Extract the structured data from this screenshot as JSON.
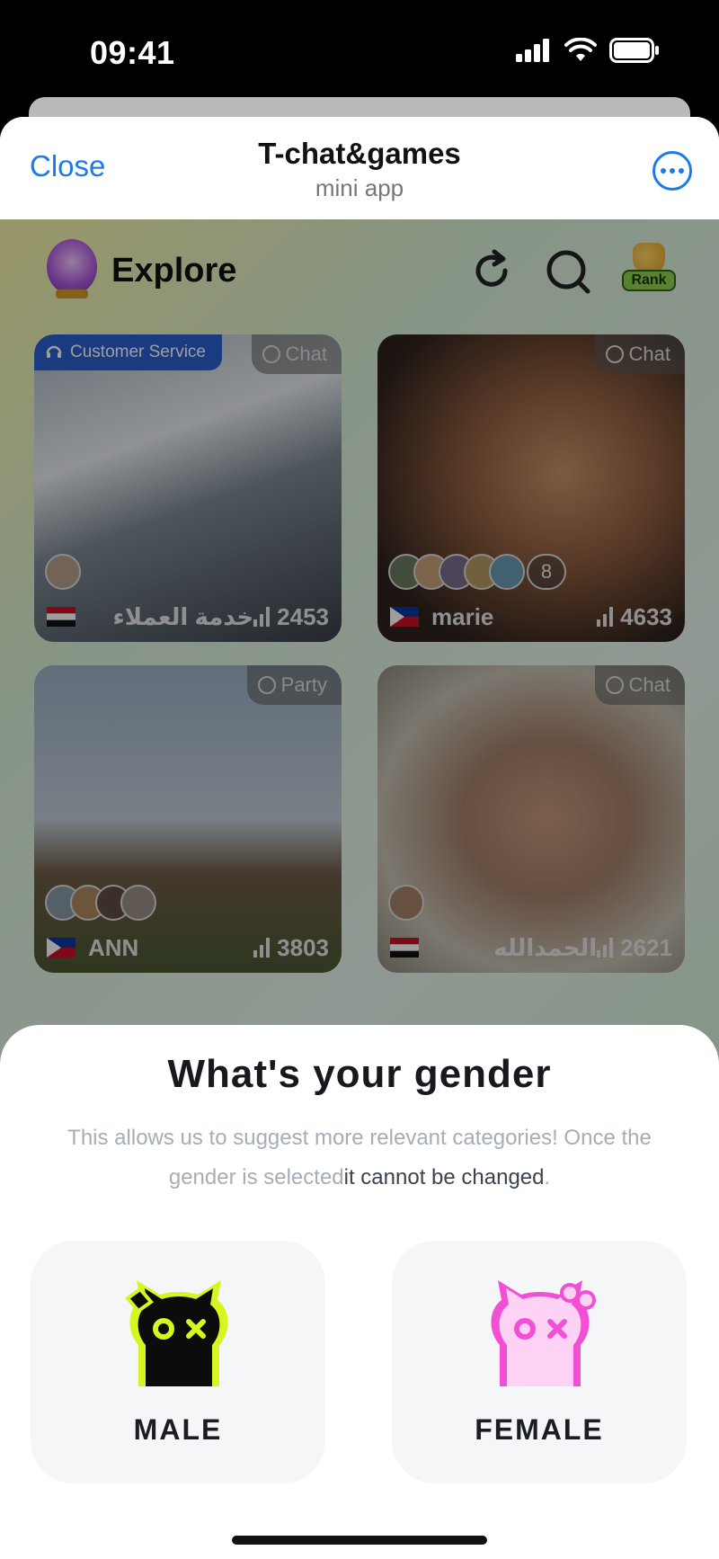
{
  "status_bar": {
    "time": "09:41"
  },
  "navbar": {
    "close_label": "Close",
    "title": "T-chat&games",
    "subtitle": "mini app"
  },
  "explore": {
    "title": "Explore",
    "rank_label": "Rank",
    "cards": [
      {
        "tag": "Chat",
        "badge": "Customer Service",
        "name": "خدمة العملاء",
        "count": "2453",
        "flag": "egypt"
      },
      {
        "tag": "Chat",
        "name": "marie",
        "count": "4633",
        "flag": "philippines",
        "extra_count": "8"
      },
      {
        "tag": "Party",
        "name": "ANN",
        "count": "3803",
        "flag": "philippines"
      },
      {
        "tag": "Chat",
        "name": "الحمدالله",
        "count": "2621",
        "flag": "egypt"
      }
    ]
  },
  "gender_sheet": {
    "heading": "What's your gender",
    "description_part1": "This allows us to suggest more relevant categories! Once the gender is selected",
    "description_strong": "it cannot be changed",
    "description_end": ".",
    "male_label": "MALE",
    "female_label": "FEMALE"
  },
  "colors": {
    "link_blue": "#1e7ae8",
    "male_accent": "#d7f51f",
    "female_accent": "#f24fd4"
  }
}
